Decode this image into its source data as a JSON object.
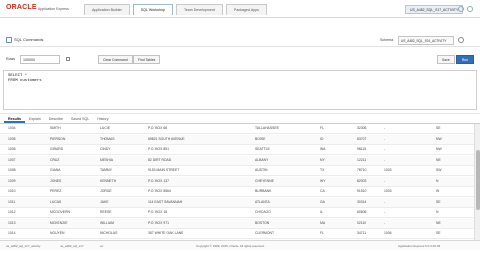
{
  "header": {
    "logo": "ORACLE",
    "logo_sub": "Application Express",
    "tabs": [
      "Application Builder",
      "SQL Workshop",
      "Team Development",
      "Packaged Apps"
    ],
    "user": "US_A482_SQL_S17_ACTIVITY"
  },
  "breadcrumb": {
    "label": "SQL Commands"
  },
  "schema": {
    "label": "Schema",
    "value": "US_A482_SQL_S01_ACTIVITY"
  },
  "toolbar": {
    "rows_label": "Rows",
    "rows_value": "100000",
    "clear_label": "Clear Command",
    "find_label": "Find Tables",
    "save_label": "Save",
    "run_label": "Run"
  },
  "editor": {
    "line1": "SELECT *",
    "line2": "FROM customers"
  },
  "result_tabs": [
    "Results",
    "Explain",
    "Describe",
    "Saved SQL",
    "History"
  ],
  "rows": [
    [
      "1004",
      "SMITH",
      "LUCIE",
      "P.O. BOX 66",
      "TALLAHASSEE",
      "FL",
      "32306",
      "-",
      "SE"
    ],
    [
      "1005",
      "PIERSON",
      "THOMAS",
      "69821 SOUTH AVENUE",
      "BOISE",
      "ID",
      "83707",
      "-",
      "NW"
    ],
    [
      "1006",
      "GIRARD",
      "CINDY",
      "P.O. BOX 851",
      "SEATTLE",
      "WA",
      "98115",
      "-",
      "NW"
    ],
    [
      "1007",
      "CRUZ",
      "MESHIA",
      "82 DIRT ROAD",
      "ALBANY",
      "NY",
      "12211",
      "-",
      "NE"
    ],
    [
      "1008",
      "GIANA",
      "TAMMY",
      "9153 MAIN STREET",
      "AUSTIN",
      "TX",
      "78710",
      "1003",
      "SW"
    ],
    [
      "1009",
      "JONES",
      "KENNETH",
      "P.O. BOX 137",
      "CHEYENNE",
      "WY",
      "82003",
      "-",
      "N"
    ],
    [
      "1010",
      "PEREZ",
      "JORGE",
      "P.O. BOX 8564",
      "BURBANK",
      "CA",
      "91510",
      "1003",
      "W"
    ],
    [
      "1011",
      "LUCAS",
      "JAKE",
      "114 EAST SAVANNAH",
      "ATLANTA",
      "GA",
      "30314",
      "-",
      "SE"
    ],
    [
      "1012",
      "MCGOVERN",
      "REESE",
      "P.O. BOX 18",
      "CHICAGO",
      "IL",
      "60606",
      "-",
      "N"
    ],
    [
      "1013",
      "MCKENZIE",
      "WILLIAM",
      "P.O. BOX 971",
      "BOSTON",
      "MA",
      "02110",
      "-",
      "NE"
    ],
    [
      "1014",
      "NGUYEN",
      "NICHOLAS",
      "357 WHITE OAK LANE",
      "CLERMONT",
      "FL",
      "34711",
      "1006",
      "SE"
    ]
  ],
  "footer": {
    "left1": "us_a482_sql_s17_activity",
    "left2": "us_a482_sql_s17",
    "lang": "en",
    "copyright": "Copyright © 1999, 2015, Oracle. All rights reserved.",
    "version": "Application Express 5.0.3.00.03"
  }
}
